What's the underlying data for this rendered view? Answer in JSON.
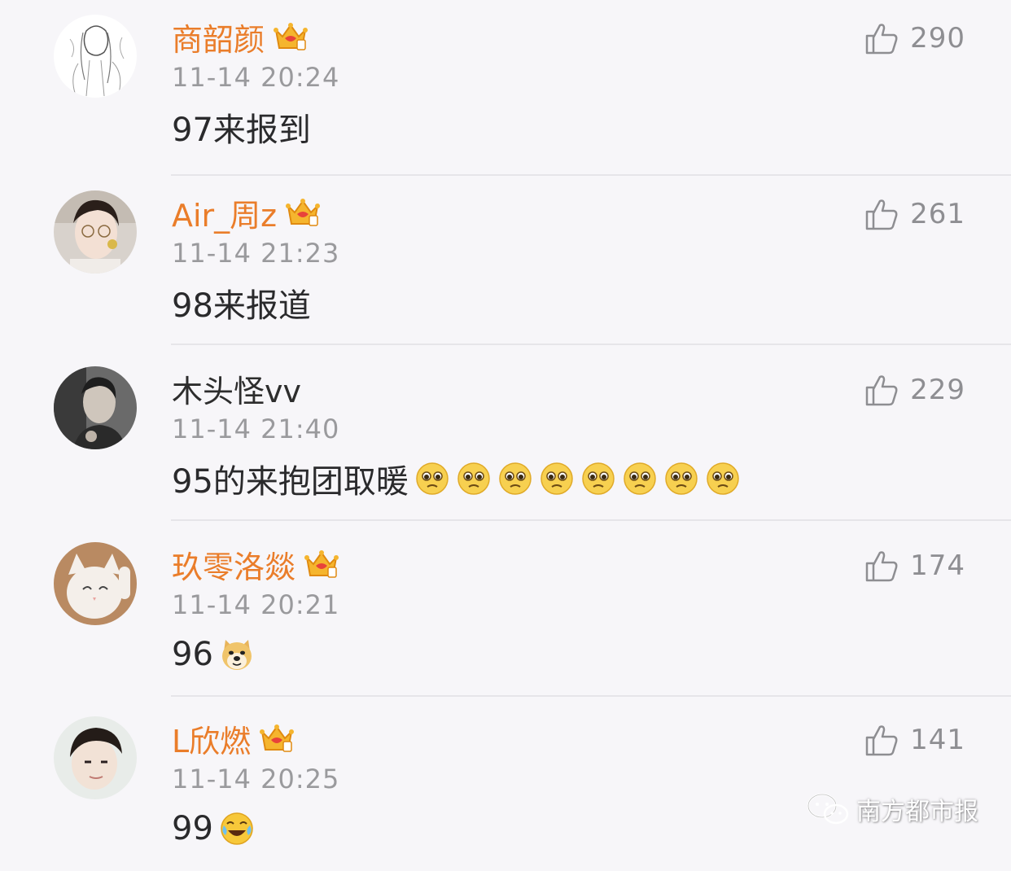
{
  "comments": [
    {
      "user": "商韶颜",
      "vip": true,
      "time": "11-14 20:24",
      "text": "97来报到",
      "likes": "290",
      "emoji": "none",
      "emoji_count": 0
    },
    {
      "user": "Air_周z",
      "vip": true,
      "time": "11-14 21:23",
      "text": "98来报道",
      "likes": "261",
      "emoji": "none",
      "emoji_count": 0
    },
    {
      "user": "木头怪vv",
      "vip": false,
      "time": "11-14 21:40",
      "text": "95的来抱团取暖",
      "likes": "229",
      "emoji": "pitiful-face-icon",
      "emoji_count": 8
    },
    {
      "user": "玖零洛燚",
      "vip": true,
      "time": "11-14 20:21",
      "text": "96",
      "likes": "174",
      "emoji": "doge-icon",
      "emoji_count": 1
    },
    {
      "user": "L欣燃",
      "vip": true,
      "time": "11-14 20:25",
      "text": "99",
      "likes": "141",
      "emoji": "laugh-cry-icon",
      "emoji_count": 1
    }
  ],
  "watermark": {
    "text": "南方都市报",
    "icon": "wechat-icon"
  },
  "colors": {
    "vip_name": "#ea7d2a",
    "name": "#2d2d2d",
    "meta": "#9a9a9d",
    "background": "#f7f6f9"
  }
}
